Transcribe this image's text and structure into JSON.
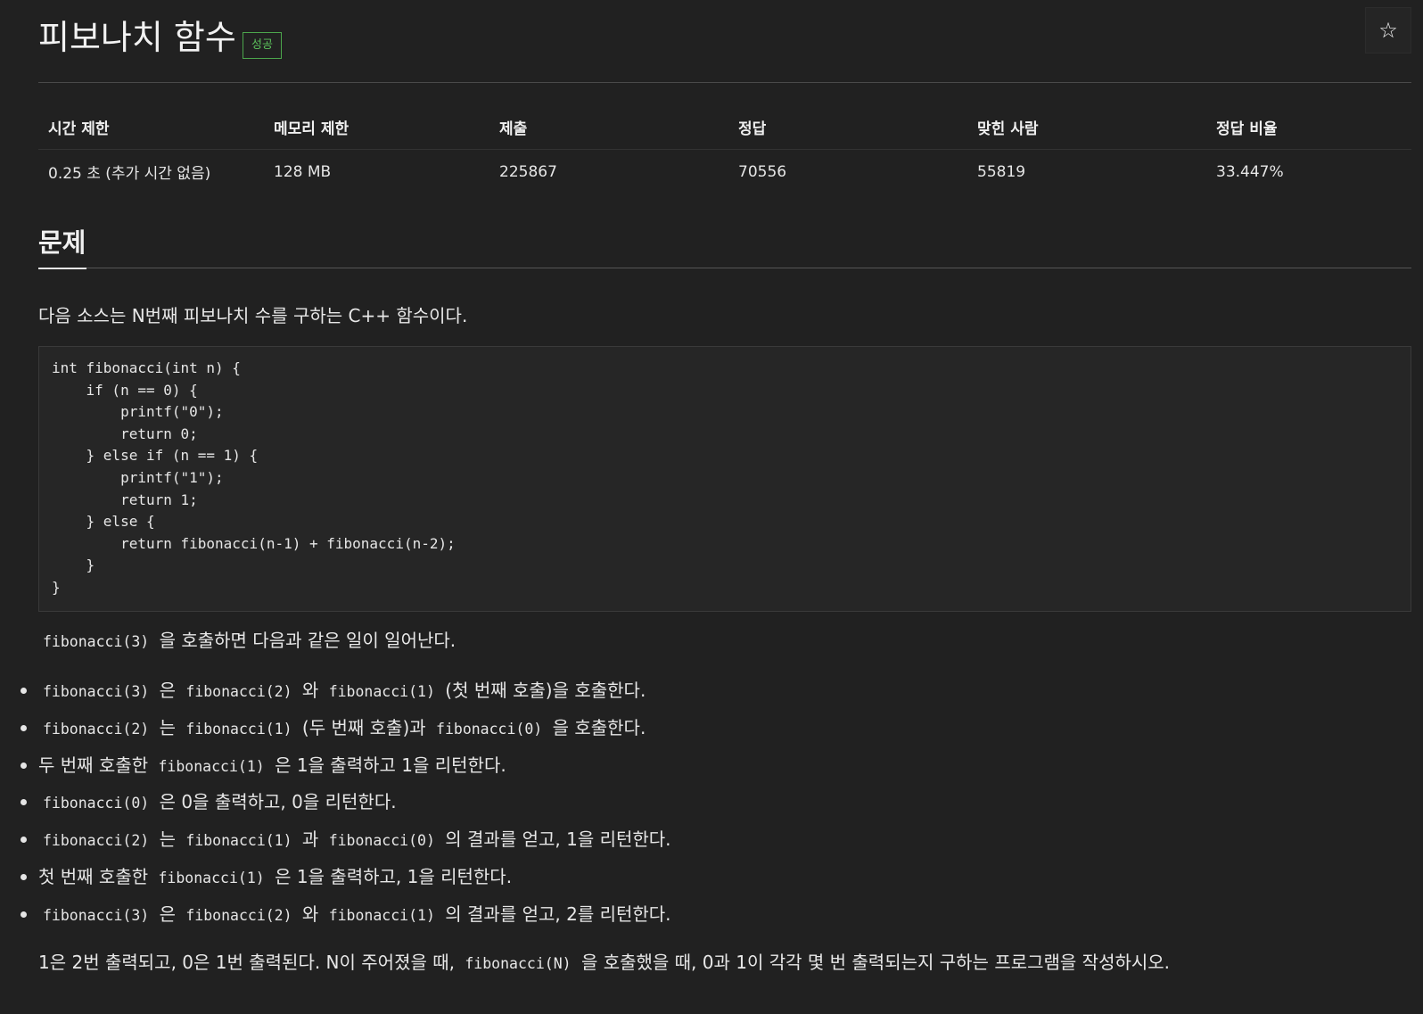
{
  "header": {
    "title": "피보나치 함수",
    "badge": "성공",
    "star_icon": "☆"
  },
  "info_table": {
    "headers": [
      "시간 제한",
      "메모리 제한",
      "제출",
      "정답",
      "맞힌 사람",
      "정답 비율"
    ],
    "values": [
      "0.25 초 (추가 시간 없음)",
      "128 MB",
      "225867",
      "70556",
      "55819",
      "33.447%"
    ]
  },
  "problem": {
    "section_title": "문제",
    "intro": "다음 소스는 N번째 피보나치 수를 구하는 C++ 함수이다.",
    "code": "int fibonacci(int n) {\n    if (n == 0) {\n        printf(\"0\");\n        return 0;\n    } else if (n == 1) {\n        printf(\"1\");\n        return 1;\n    } else {\n        return fibonacci(n‐1) + fibonacci(n‐2);\n    }\n}",
    "call_code": "fibonacci(3)",
    "call_text": "을 호출하면 다음과 같은 일이 일어난다.",
    "steps": [
      {
        "a": "fibonacci(3)",
        "b": "은",
        "c": "fibonacci(2)",
        "d": "와",
        "e": "fibonacci(1)",
        "f": "(첫 번째 호출)을 호출한다."
      },
      {
        "a": "fibonacci(2)",
        "b": "는",
        "c": "fibonacci(1)",
        "d": "(두 번째 호출)과",
        "e": "fibonacci(0)",
        "f": "을 호출한다."
      },
      {
        "pre": "두 번째 호출한",
        "a": "fibonacci(1)",
        "f": "은 1을 출력하고 1을 리턴한다."
      },
      {
        "a": "fibonacci(0)",
        "f": "은 0을 출력하고, 0을 리턴한다."
      },
      {
        "a": "fibonacci(2)",
        "b": "는",
        "c": "fibonacci(1)",
        "d": "과",
        "e": "fibonacci(0)",
        "f": "의 결과를 얻고, 1을 리턴한다."
      },
      {
        "pre": "첫 번째 호출한",
        "a": "fibonacci(1)",
        "f": "은 1을 출력하고, 1을 리턴한다."
      },
      {
        "a": "fibonacci(3)",
        "b": "은",
        "c": "fibonacci(2)",
        "d": "와",
        "e": "fibonacci(1)",
        "f": "의 결과를 얻고, 2를 리턴한다."
      }
    ],
    "closing_pre": "1은 2번 출력되고, 0은 1번 출력된다. N이 주어졌을 때,",
    "closing_code": "fibonacci(N)",
    "closing_post": "을 호출했을 때, 0과 1이 각각 몇 번 출력되는지 구하는 프로그램을 작성하시오."
  },
  "colors": {
    "background": "#212121",
    "text": "#e6e6e6",
    "badge_success": "#5cc15c"
  }
}
